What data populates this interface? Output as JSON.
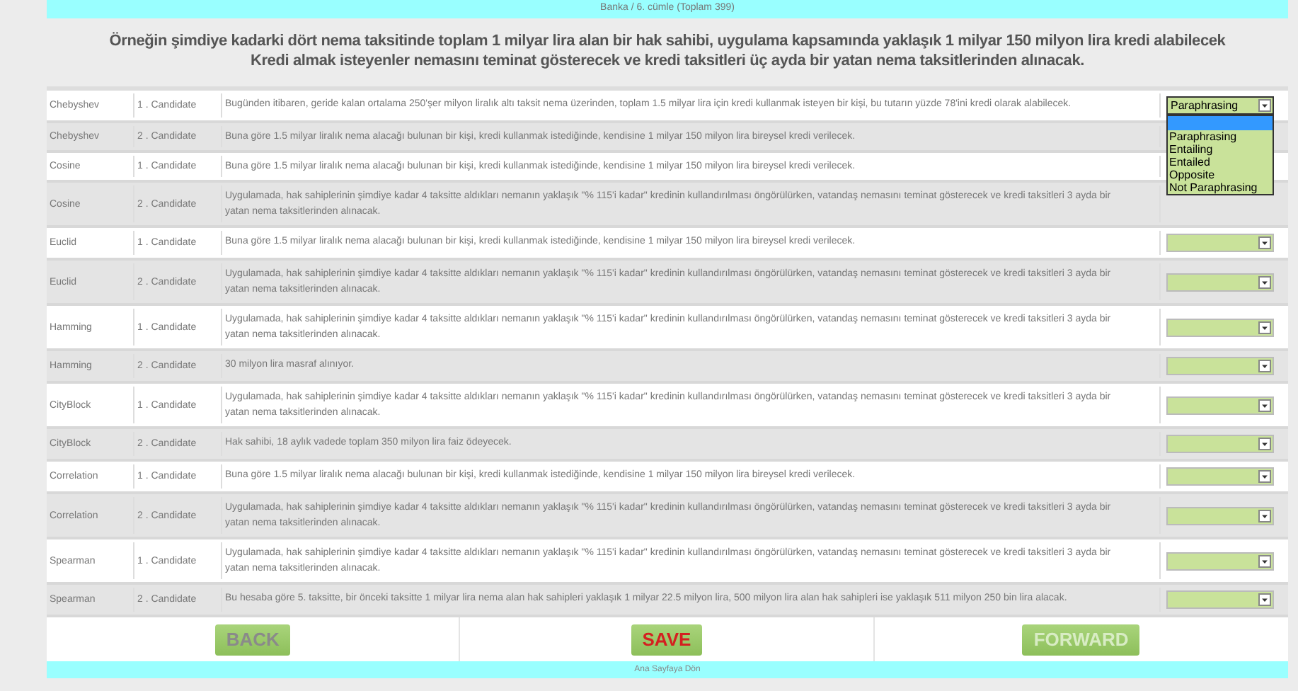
{
  "header": {
    "title": "Banka / 6. cümle (Toplam 399)"
  },
  "sentence": "Örneğin şimdiye kadarki dört nema taksitinde toplam 1 milyar lira alan bir hak sahibi, uygulama kapsamında yaklaşık 1 milyar 150 milyon lira kredi alabilecek Kredi almak isteyenler nemasını teminat gösterecek ve kredi taksitleri üç ayda bir yatan nema taksitlerinden alınacak.",
  "rows": [
    {
      "method": "Chebyshev",
      "candidate": "1 . Candidate",
      "text": "Bugünden itibaren, geride kalan ortalama 250'şer milyon liralık altı taksit nema üzerinden, toplam 1.5 milyar lira için kredi kullanmak isteyen bir kişi, bu tutarın yüzde 78'ini kredi olarak alabilecek.",
      "answer": "Paraphrasing",
      "expanded": true,
      "blank_highlighted": true,
      "options": [
        "Paraphrasing",
        "Entailing",
        "Entailed",
        "Opposite",
        "Not Paraphrasing"
      ]
    },
    {
      "method": "Chebyshev",
      "candidate": "2 . Candidate",
      "text": "Buna göre 1.5 milyar liralık nema alacağı bulunan bir kişi, kredi kullanmak istediğinde, kendisine 1 milyar 150 milyon lira bireysel kredi verilecek.",
      "expanded": false
    },
    {
      "method": "Cosine",
      "candidate": "1 . Candidate",
      "text": "Buna göre 1.5 milyar liralık nema alacağı bulunan bir kişi, kredi kullanmak istediğinde, kendisine 1 milyar 150 milyon lira bireysel kredi verilecek.",
      "expanded": false
    },
    {
      "method": "Cosine",
      "candidate": "2 . Candidate",
      "text": "Uygulamada, hak sahiplerinin şimdiye kadar 4 taksitte aldıkları nemanın yaklaşık \"% 115'i kadar\" kredinin kullandırılması öngörülürken, vatandaş nemasını teminat gösterecek ve kredi taksitleri 3 ayda bir yatan nema taksitlerinden alınacak.",
      "expanded": false
    },
    {
      "method": "Euclid",
      "candidate": "1 . Candidate",
      "text": "Buna göre 1.5 milyar liralık nema alacağı bulunan bir kişi, kredi kullanmak istediğinde, kendisine 1 milyar 150 milyon lira bireysel kredi verilecek.",
      "expanded": false
    },
    {
      "method": "Euclid",
      "candidate": "2 . Candidate",
      "text": "Uygulamada, hak sahiplerinin şimdiye kadar 4 taksitte aldıkları nemanın yaklaşık \"% 115'i kadar\" kredinin kullandırılması öngörülürken, vatandaş nemasını teminat gösterecek ve kredi taksitleri 3 ayda bir yatan nema taksitlerinden alınacak.",
      "expanded": false
    },
    {
      "method": "Hamming",
      "candidate": "1 . Candidate",
      "text": "Uygulamada, hak sahiplerinin şimdiye kadar 4 taksitte aldıkları nemanın yaklaşık \"% 115'i kadar\" kredinin kullandırılması öngörülürken, vatandaş nemasını teminat gösterecek ve kredi taksitleri 3 ayda bir yatan nema taksitlerinden alınacak.",
      "expanded": false
    },
    {
      "method": "Hamming",
      "candidate": "2 . Candidate",
      "text": "30 milyon lira masraf alınıyor.",
      "expanded": false
    },
    {
      "method": "CityBlock",
      "candidate": "1 . Candidate",
      "text": "Uygulamada, hak sahiplerinin şimdiye kadar 4 taksitte aldıkları nemanın yaklaşık \"% 115'i kadar\" kredinin kullandırılması öngörülürken, vatandaş nemasını teminat gösterecek ve kredi taksitleri 3 ayda bir yatan nema taksitlerinden alınacak.",
      "expanded": false
    },
    {
      "method": "CityBlock",
      "candidate": "2 . Candidate",
      "text": "Hak sahibi, 18 aylık vadede toplam 350 milyon lira faiz ödeyecek.",
      "expanded": false
    },
    {
      "method": "Correlation",
      "candidate": "1 . Candidate",
      "text": "Buna göre 1.5 milyar liralık nema alacağı bulunan bir kişi, kredi kullanmak istediğinde, kendisine 1 milyar 150 milyon lira bireysel kredi verilecek.",
      "expanded": false
    },
    {
      "method": "Correlation",
      "candidate": "2 . Candidate",
      "text": "Uygulamada, hak sahiplerinin şimdiye kadar 4 taksitte aldıkları nemanın yaklaşık \"% 115'i kadar\" kredinin kullandırılması öngörülürken, vatandaş nemasını teminat gösterecek ve kredi taksitleri 3 ayda bir yatan nema taksitlerinden alınacak.",
      "expanded": false
    },
    {
      "method": "Spearman",
      "candidate": "1 . Candidate",
      "text": "Uygulamada, hak sahiplerinin şimdiye kadar 4 taksitte aldıkları nemanın yaklaşık \"% 115'i kadar\" kredinin kullandırılması öngörülürken, vatandaş nemasını teminat gösterecek ve kredi taksitleri 3 ayda bir yatan nema taksitlerinden alınacak.",
      "expanded": false
    },
    {
      "method": "Spearman",
      "candidate": "2 . Candidate",
      "text": "Bu hesaba göre 5. taksitte, bir önceki taksitte 1 milyar lira nema alan hak sahipleri yaklaşık 1 milyar 22.5 milyon lira, 500 milyon lira alan hak sahipleri ise yaklaşık 511 milyon 250 bin lira alacak.",
      "expanded": false
    }
  ],
  "buttons": [
    {
      "label": "BACK",
      "kind": "back"
    },
    {
      "label": "SAVE",
      "kind": "save"
    },
    {
      "label": "FORWARD",
      "kind": "forward"
    }
  ],
  "footer": {
    "link": "Ana Sayfaya Dön"
  }
}
